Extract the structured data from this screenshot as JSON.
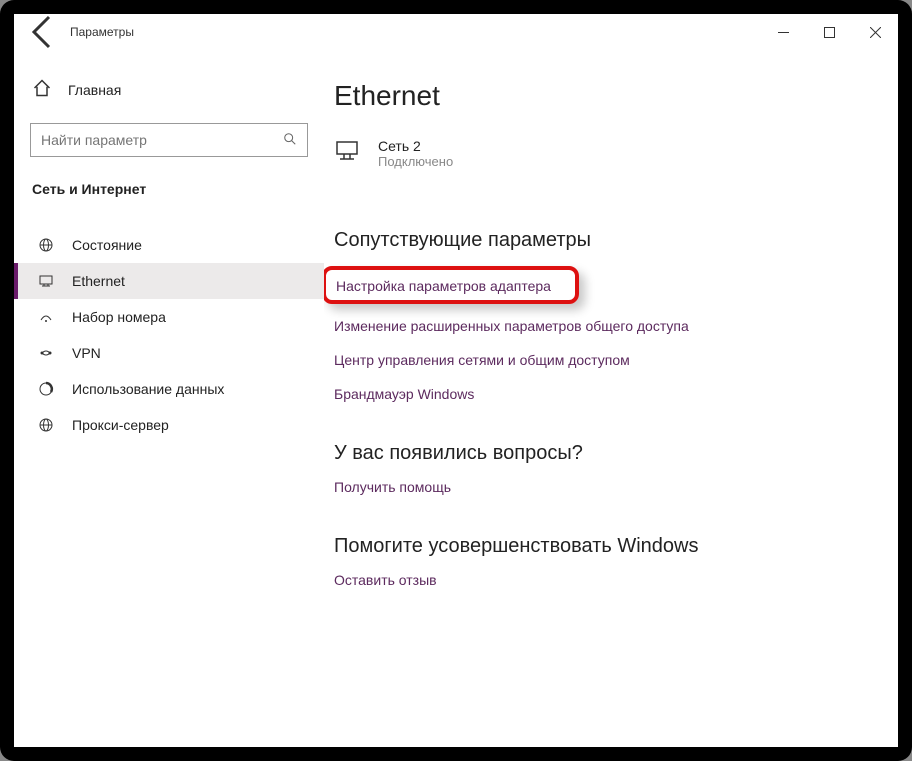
{
  "titlebar": {
    "title": "Параметры"
  },
  "sidebar": {
    "home": "Главная",
    "search_placeholder": "Найти параметр",
    "section": "Сеть и Интернет",
    "items": [
      {
        "label": "Состояние"
      },
      {
        "label": "Ethernet"
      },
      {
        "label": "Набор номера"
      },
      {
        "label": "VPN"
      },
      {
        "label": "Использование данных"
      },
      {
        "label": "Прокси-сервер"
      }
    ]
  },
  "main": {
    "title": "Ethernet",
    "network": {
      "name": "Сеть 2",
      "status": "Подключено"
    },
    "related_header": "Сопутствующие параметры",
    "links": [
      "Настройка параметров адаптера",
      "Изменение расширенных параметров общего доступа",
      "Центр управления сетями и общим доступом",
      "Брандмауэр Windows"
    ],
    "questions_header": "У вас появились вопросы?",
    "questions_link": "Получить помощь",
    "improve_header": "Помогите усовершенствовать Windows",
    "improve_link": "Оставить отзыв"
  }
}
